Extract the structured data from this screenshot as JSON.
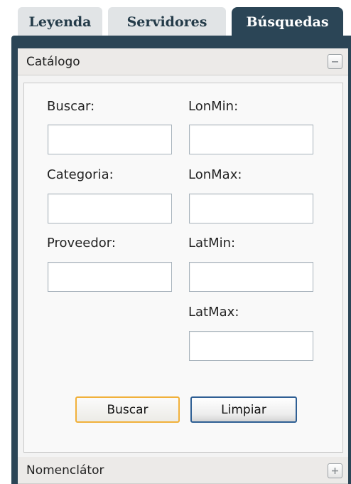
{
  "tabs": [
    {
      "label": "Leyenda",
      "active": false
    },
    {
      "label": "Servidores",
      "active": false
    },
    {
      "label": "Búsquedas",
      "active": true
    }
  ],
  "sections": {
    "catalog": {
      "title": "Catálogo",
      "toggle_icon": "collapse-minus-icon",
      "expanded": true,
      "fields": {
        "buscar": {
          "label": "Buscar:",
          "value": ""
        },
        "categoria": {
          "label": "Categoria:",
          "value": ""
        },
        "proveedor": {
          "label": "Proveedor:",
          "value": ""
        },
        "lonmin": {
          "label": "LonMin:",
          "value": ""
        },
        "lonmax": {
          "label": "LonMax:",
          "value": ""
        },
        "latmin": {
          "label": "LatMin:",
          "value": ""
        },
        "latmax": {
          "label": "LatMax:",
          "value": ""
        }
      },
      "buttons": {
        "search": "Buscar",
        "clear": "Limpiar"
      }
    },
    "gazetteer": {
      "title": "Nomenclátor",
      "toggle_icon": "expand-plus-icon",
      "expanded": false
    }
  },
  "colors": {
    "frame": "#2b4556",
    "tab_inactive": "#e1e4e6",
    "header_bg": "#eceae8",
    "primary_border": "#f1b13b",
    "secondary_border": "#2f5f94"
  }
}
